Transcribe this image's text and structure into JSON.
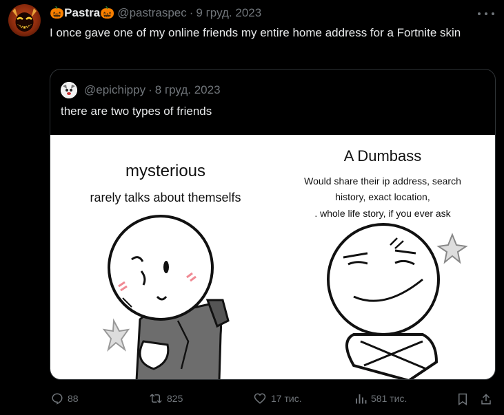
{
  "tweet": {
    "display_name": "🎃Pastra🎃",
    "handle": "@pastraspec",
    "date": "9 груд. 2023",
    "text": "I once gave one of my online friends my entire home address for a Fortnite skin",
    "avatar_icon": "demon-avatar"
  },
  "quote": {
    "handle": "@epichippy",
    "date": "8 груд. 2023",
    "text": "there are two types of friends",
    "avatar_icon": "dog-avatar",
    "image": {
      "left_title": "mysterious",
      "left_subtitle": "rarely talks about themselfs",
      "right_title": "A  Dumbass",
      "right_line1": "Would share their ip address, search",
      "right_line2": "history, exact location,",
      "right_line3": ". whole life  story, if you ever ask"
    }
  },
  "actions": {
    "replies": "88",
    "reposts": "825",
    "likes": "17 тис.",
    "views": "581 тис."
  },
  "colors": {
    "background": "#000000",
    "text": "#e7e9ea",
    "muted": "#71767b",
    "border": "#2f3336",
    "blush": "#f08a94"
  }
}
